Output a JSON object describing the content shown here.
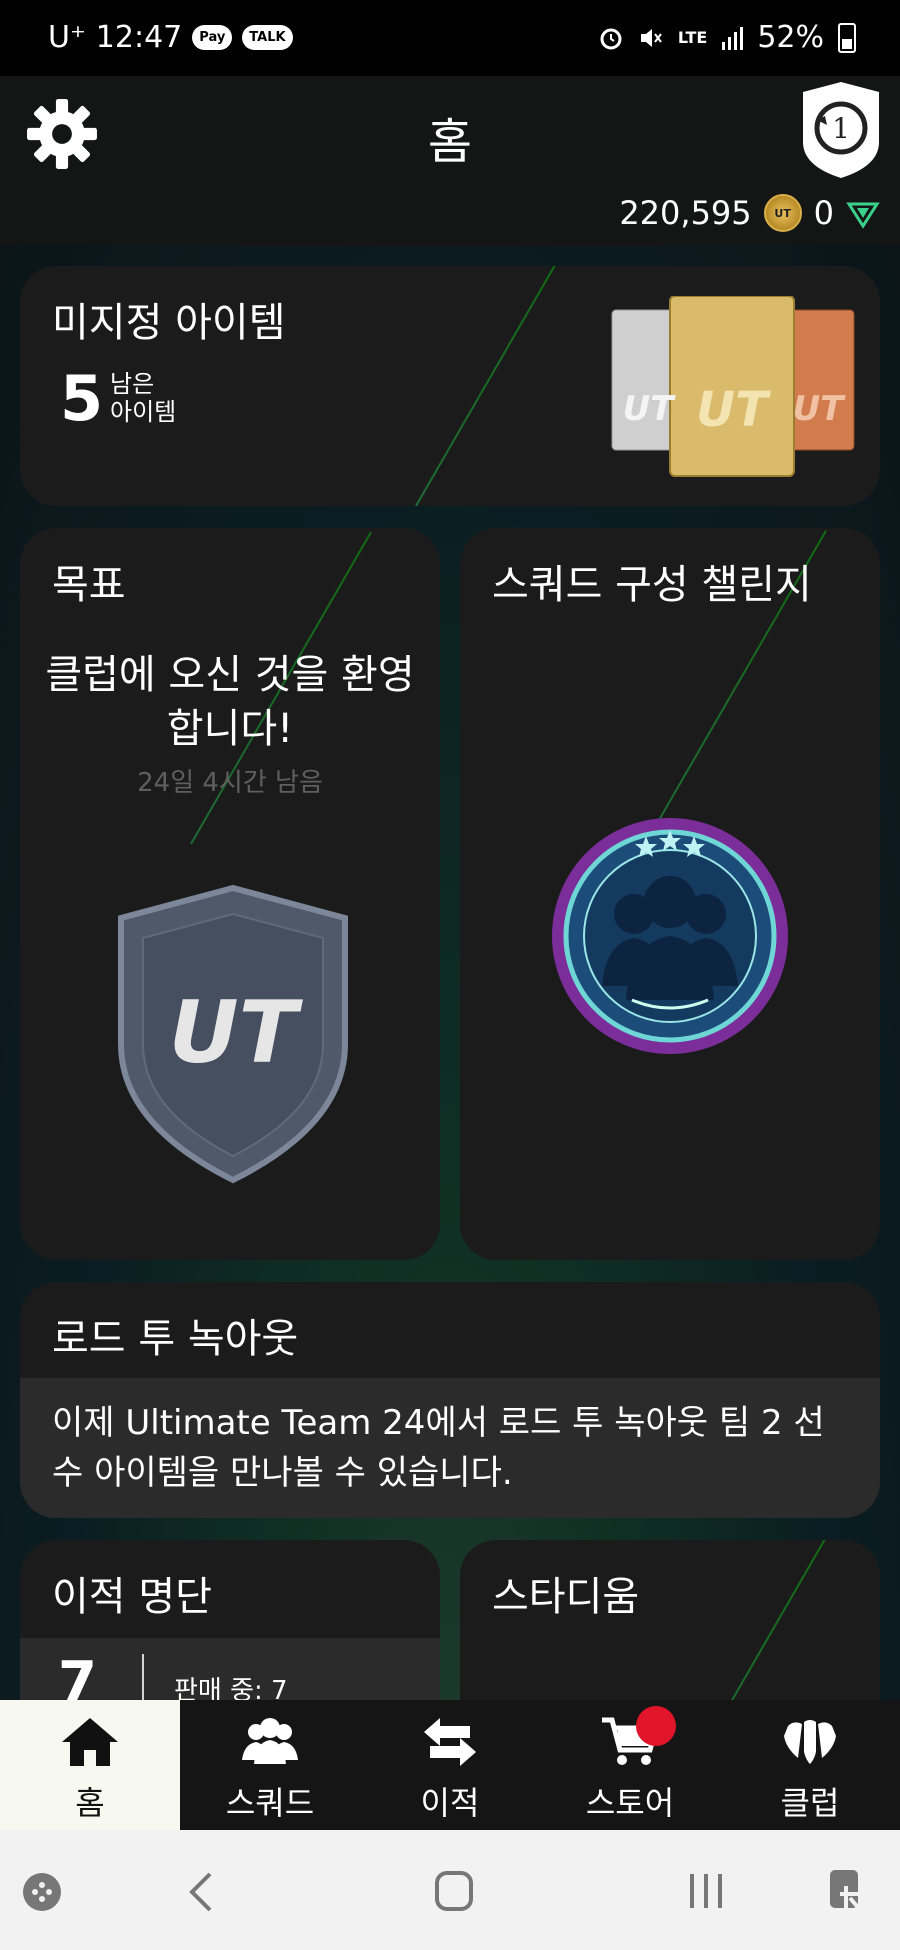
{
  "status": {
    "carrier": "U⁺",
    "time": "12:47",
    "pay": "Pay",
    "talk": "TALK",
    "network": "LTE",
    "battery": "52%"
  },
  "header": {
    "title": "홈",
    "coins": "220,595",
    "points": "0"
  },
  "unassigned": {
    "title": "미지정 아이템",
    "count": "5",
    "count_label_1": "남은",
    "count_label_2": "아이템"
  },
  "goals": {
    "title": "목표",
    "welcome_1": "클럽에 오신 것을 환영",
    "welcome_2": "합니다!",
    "remaining": "24일 4시간 남음",
    "shield_text": "UT"
  },
  "sbc": {
    "title": "스쿼드 구성 챌린지"
  },
  "rtk": {
    "title": "로드 투 녹아웃",
    "body": "이제 Ultimate Team 24에서 로드 투 녹아웃 팀 2 선수 아이템을 만나볼 수 있습니다."
  },
  "transfer_list": {
    "title": "이적 명단",
    "count": "7",
    "on_sale": "판매 중: 7"
  },
  "stadium": {
    "title": "스타디움"
  },
  "tabs": [
    {
      "label": "홈",
      "icon": "home-icon"
    },
    {
      "label": "스쿼드",
      "icon": "squad-icon"
    },
    {
      "label": "이적",
      "icon": "transfer-icon"
    },
    {
      "label": "스토어",
      "icon": "cart-icon"
    },
    {
      "label": "클럽",
      "icon": "club-icon"
    }
  ],
  "colors": {
    "accent_active_tab": "#f7f9f1",
    "notification": "#e0152a",
    "card_bg": "#1b1b1b"
  }
}
